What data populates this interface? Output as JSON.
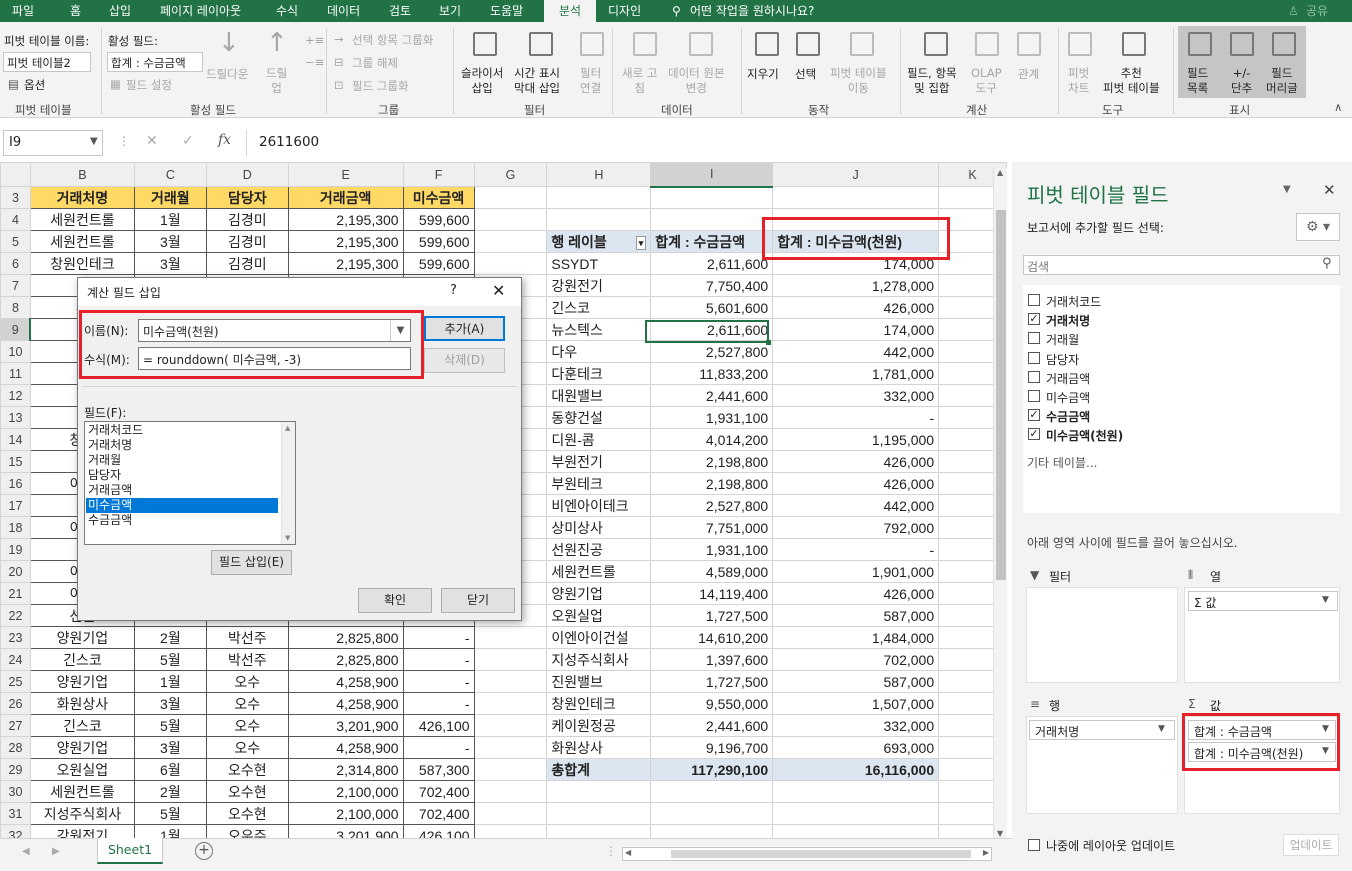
{
  "ribbon_tabs": [
    "파일",
    "홈",
    "삽입",
    "페이지 레이아웃",
    "수식",
    "데이터",
    "검토",
    "보기",
    "도움말",
    "분석",
    "디자인"
  ],
  "tell_me": "어떤 작업을 원하시나요?",
  "share": "공유",
  "ribbon": {
    "pivot_name_label": "피벗 테이블 이름:",
    "pivot_name_value": "피벗 테이블2",
    "options": "옵션",
    "active_field_label": "활성 필드:",
    "active_field_value": "합계 : 수금금액",
    "field_settings": "필드 설정",
    "drill_down": "드릴다운",
    "drill_up": "드릴\n업",
    "group_selection": "선택 항목 그룹화",
    "ungroup": "그룹 해제",
    "group_field": "필드 그룹화",
    "slicer_insert": "슬라이서\n삽입",
    "timeline_insert": "시간 표시\n막대 삽입",
    "filter_connections": "필터\n연결",
    "refresh": "새로 고\n침",
    "change_source": "데이터 원본\n변경",
    "clear": "지우기",
    "select": "선택",
    "move_pivot": "피벗 테이블\n이동",
    "fields_items_sets": "필드, 항목\n및 집합",
    "olap_tools": "OLAP\n도구",
    "relationships": "관계",
    "pivot_chart": "피벗\n차트",
    "recommended_pivot": "추천\n피벗 테이블",
    "field_list": "필드\n목록",
    "plus_minus": "+/-\n단추",
    "field_headers": "필드\n머리글",
    "groups": [
      "피벗 테이블",
      "활성 필드",
      "그룹",
      "필터",
      "데이터",
      "동작",
      "계산",
      "도구",
      "표시"
    ]
  },
  "formula_bar": {
    "name_box": "I9",
    "formula": "2611600"
  },
  "col_headers": [
    "B",
    "C",
    "D",
    "E",
    "F",
    "G",
    "H",
    "I",
    "J",
    "K"
  ],
  "data_headers": [
    "거래처명",
    "거래월",
    "담당자",
    "거래금액",
    "미수금액"
  ],
  "data_rows": [
    {
      "row": "3",
      "hdr": true
    },
    {
      "row": "4",
      "cells": [
        "세원컨트롤",
        "1월",
        "김경미",
        "2,195,300",
        "599,600"
      ]
    },
    {
      "row": "5",
      "cells": [
        "세원컨트롤",
        "3월",
        "김경미",
        "2,195,300",
        "599,600"
      ]
    },
    {
      "row": "6",
      "cells": [
        "창원인테크",
        "3월",
        "김경미",
        "2,195,300",
        "599,600"
      ]
    },
    {
      "row": "7",
      "cells": [
        "다",
        "",
        "",
        "",
        ""
      ]
    },
    {
      "row": "8",
      "cells": [
        "부",
        "",
        "",
        "",
        ""
      ]
    },
    {
      "row": "9",
      "cells": [
        "다",
        "",
        "",
        "",
        ""
      ]
    },
    {
      "row": "10",
      "cells": [
        "강",
        "",
        "",
        "",
        ""
      ]
    },
    {
      "row": "11",
      "cells": [
        "다",
        "",
        "",
        "",
        ""
      ]
    },
    {
      "row": "12",
      "cells": [
        "다",
        "",
        "",
        "",
        ""
      ]
    },
    {
      "row": "13",
      "cells": [
        "대",
        "",
        "",
        "",
        ""
      ]
    },
    {
      "row": "14",
      "cells": [
        "창원",
        "",
        "",
        "",
        ""
      ]
    },
    {
      "row": "15",
      "cells": [
        "디",
        "",
        "",
        "",
        ""
      ]
    },
    {
      "row": "16",
      "cells": [
        "이엔",
        "",
        "",
        "",
        ""
      ]
    },
    {
      "row": "17",
      "cells": [
        "상",
        "",
        "",
        "",
        ""
      ]
    },
    {
      "row": "18",
      "cells": [
        "이엔",
        "",
        "",
        "",
        ""
      ]
    },
    {
      "row": "19",
      "cells": [
        "",
        "",
        "",
        "",
        ""
      ]
    },
    {
      "row": "20",
      "cells": [
        "이엔",
        "",
        "",
        "",
        ""
      ]
    },
    {
      "row": "21",
      "cells": [
        "이엔",
        "",
        "",
        "",
        ""
      ]
    },
    {
      "row": "22",
      "cells": [
        "선원",
        "",
        "",
        "",
        ""
      ]
    },
    {
      "row": "23",
      "cells": [
        "양원기업",
        "2월",
        "박선주",
        "2,825,800",
        "-"
      ]
    },
    {
      "row": "24",
      "cells": [
        "긴스코",
        "5월",
        "박선주",
        "2,825,800",
        "-"
      ]
    },
    {
      "row": "25",
      "cells": [
        "양원기업",
        "1월",
        "오수",
        "4,258,900",
        "-"
      ]
    },
    {
      "row": "26",
      "cells": [
        "화원상사",
        "3월",
        "오수",
        "4,258,900",
        "-"
      ]
    },
    {
      "row": "27",
      "cells": [
        "긴스코",
        "5월",
        "오수",
        "3,201,900",
        "426,100"
      ]
    },
    {
      "row": "28",
      "cells": [
        "양원기업",
        "3월",
        "오수",
        "4,258,900",
        "-"
      ]
    },
    {
      "row": "29",
      "cells": [
        "오원실업",
        "6월",
        "오수현",
        "2,314,800",
        "587,300"
      ]
    },
    {
      "row": "30",
      "cells": [
        "세원컨트롤",
        "2월",
        "오수현",
        "2,100,000",
        "702,400"
      ]
    },
    {
      "row": "31",
      "cells": [
        "지성주식회사",
        "5월",
        "오수현",
        "2,100,000",
        "702,400"
      ]
    },
    {
      "row": "32",
      "cells": [
        "강원전기",
        "1월",
        "오우주",
        "3,201,900",
        "426,100"
      ]
    }
  ],
  "pivot": {
    "header": [
      "행 레이블",
      "합계 : 수금금액",
      "합계 : 미수금액(천원)"
    ],
    "rows": [
      [
        "SSYDT",
        "2,611,600",
        "174,000"
      ],
      [
        "강원전기",
        "7,750,400",
        "1,278,000"
      ],
      [
        "긴스코",
        "5,601,600",
        "426,000"
      ],
      [
        "뉴스텍스",
        "2,611,600",
        "174,000"
      ],
      [
        "다우",
        "2,527,800",
        "442,000"
      ],
      [
        "다훈테크",
        "11,833,200",
        "1,781,000"
      ],
      [
        "대원밸브",
        "2,441,600",
        "332,000"
      ],
      [
        "동향건설",
        "1,931,100",
        "-"
      ],
      [
        "디원-콤",
        "4,014,200",
        "1,195,000"
      ],
      [
        "부원전기",
        "2,198,800",
        "426,000"
      ],
      [
        "부원테크",
        "2,198,800",
        "426,000"
      ],
      [
        "비엔아이테크",
        "2,527,800",
        "442,000"
      ],
      [
        "상미상사",
        "7,751,000",
        "792,000"
      ],
      [
        "선원진공",
        "1,931,100",
        "-"
      ],
      [
        "세원컨트롤",
        "4,589,000",
        "1,901,000"
      ],
      [
        "양원기업",
        "14,119,400",
        "426,000"
      ],
      [
        "오원실업",
        "1,727,500",
        "587,000"
      ],
      [
        "이엔아이건설",
        "14,610,200",
        "1,484,000"
      ],
      [
        "지성주식회사",
        "1,397,600",
        "702,000"
      ],
      [
        "진원밸브",
        "1,727,500",
        "587,000"
      ],
      [
        "창원인테크",
        "9,550,000",
        "1,507,000"
      ],
      [
        "케이원정공",
        "2,441,600",
        "332,000"
      ],
      [
        "화원상사",
        "9,196,700",
        "693,000"
      ]
    ],
    "total": [
      "총합계",
      "117,290,100",
      "16,116,000"
    ]
  },
  "dialog": {
    "title": "계산 필드 삽입",
    "help": "?",
    "name_label": "이름(N):",
    "name_value": "미수금액(천원)",
    "formula_label": "수식(M):",
    "formula_value": "= rounddown( 미수금액, -3)",
    "add": "추가(A)",
    "delete": "삭제(D)",
    "fields_label": "필드(F):",
    "fields": [
      "거래처코드",
      "거래처명",
      "거래월",
      "담당자",
      "거래금액",
      "미수금액",
      "수금금액"
    ],
    "selected_field": "미수금액",
    "insert_field": "필드 삽입(E)",
    "ok": "확인",
    "close": "닫기"
  },
  "pane": {
    "title": "피벗 테이블 필드",
    "subtitle": "보고서에 추가할 필드 선택:",
    "search_placeholder": "검색",
    "fields": [
      {
        "name": "거래처코드",
        "checked": false
      },
      {
        "name": "거래처명",
        "checked": true
      },
      {
        "name": "거래월",
        "checked": false
      },
      {
        "name": "담당자",
        "checked": false
      },
      {
        "name": "거래금액",
        "checked": false
      },
      {
        "name": "미수금액",
        "checked": false
      },
      {
        "name": "수금금액",
        "checked": true
      },
      {
        "name": "미수금액(천원)",
        "checked": true
      }
    ],
    "more_tables": "기타 테이블...",
    "drag_hint": "아래 영역 사이에 필드를 끌어 놓으십시오.",
    "filter_area": "필터",
    "columns_area": "열",
    "rows_area": "행",
    "values_area": "값",
    "columns_item": "Σ 값",
    "rows_item": "거래처명",
    "values_items": [
      "합계 : 수금금액",
      "합계 : 미수금액(천원)"
    ],
    "defer_update": "나중에 레이아웃 업데이트",
    "update_button": "업데이트"
  },
  "sheet_tab": "Sheet1",
  "colors": {
    "excel_green": "#217346",
    "red_highlight": "#e8202a",
    "header_fill": "#ffd966",
    "pivot_fill": "#dce6f1",
    "selection": "#0078d7"
  }
}
